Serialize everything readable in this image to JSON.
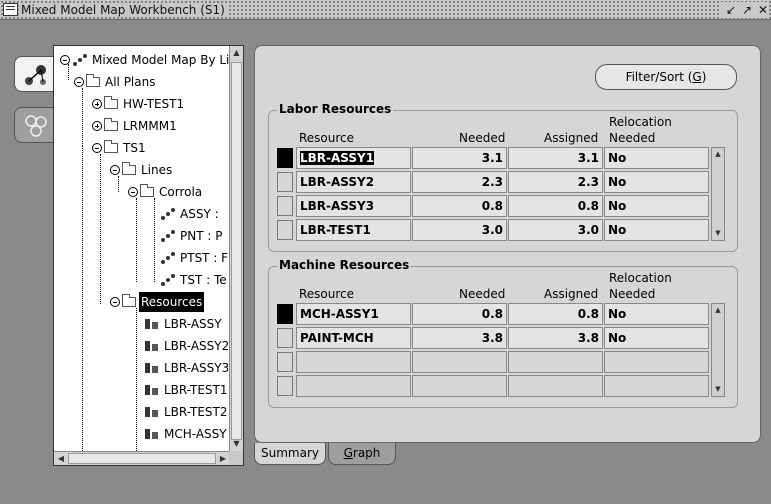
{
  "window": {
    "title": "Mixed Model Map Workbench (S1)",
    "controls": [
      "minimize",
      "maximize",
      "close"
    ]
  },
  "side_tabs": [
    {
      "icon": "hierarchy-icon",
      "active": true
    },
    {
      "icon": "cluster-icon",
      "active": false
    }
  ],
  "tree": {
    "root": "Mixed Model Map By Li",
    "all_plans": "All Plans",
    "plans": [
      "HW-TEST1",
      "LRMMM1",
      "TS1"
    ],
    "lines": "Lines",
    "line_name": "Corrola",
    "line_items": [
      "ASSY :",
      "PNT : P",
      "PTST : F",
      "TST : Te"
    ],
    "resources": "Resources",
    "resource_items": [
      "LBR-ASSY",
      "LBR-ASSY2",
      "LBR-ASSY3",
      "LBR-TEST1",
      "LBR-TEST2",
      "MCH-ASSY"
    ]
  },
  "filter_button": {
    "label_pre": "Filter/Sort (",
    "label_key": "G",
    "label_post": ")"
  },
  "labor": {
    "title": "Labor Resources",
    "headers": {
      "resource": "Resource",
      "needed": "Needed",
      "assigned": "Assigned",
      "relocation_1": "Relocation",
      "relocation_2": "Needed"
    },
    "rows": [
      {
        "resource": "LBR-ASSY1",
        "needed": "3.1",
        "assigned": "3.1",
        "relocation": "No"
      },
      {
        "resource": "LBR-ASSY2",
        "needed": "2.3",
        "assigned": "2.3",
        "relocation": "No"
      },
      {
        "resource": "LBR-ASSY3",
        "needed": "0.8",
        "assigned": "0.8",
        "relocation": "No"
      },
      {
        "resource": "LBR-TEST1",
        "needed": "3.0",
        "assigned": "3.0",
        "relocation": "No"
      }
    ]
  },
  "machine": {
    "title": "Machine Resources",
    "headers": {
      "resource": "Resource",
      "needed": "Needed",
      "assigned": "Assigned",
      "relocation_1": "Relocation",
      "relocation_2": "Needed"
    },
    "rows": [
      {
        "resource": "MCH-ASSY1",
        "needed": "0.8",
        "assigned": "0.8",
        "relocation": "No"
      },
      {
        "resource": "PAINT-MCH",
        "needed": "3.8",
        "assigned": "3.8",
        "relocation": "No"
      },
      {
        "resource": "",
        "needed": "",
        "assigned": "",
        "relocation": ""
      },
      {
        "resource": "",
        "needed": "",
        "assigned": "",
        "relocation": ""
      }
    ]
  },
  "bottom_tabs": {
    "summary": "Summary",
    "graph_key": "G",
    "graph_rest": "raph"
  }
}
